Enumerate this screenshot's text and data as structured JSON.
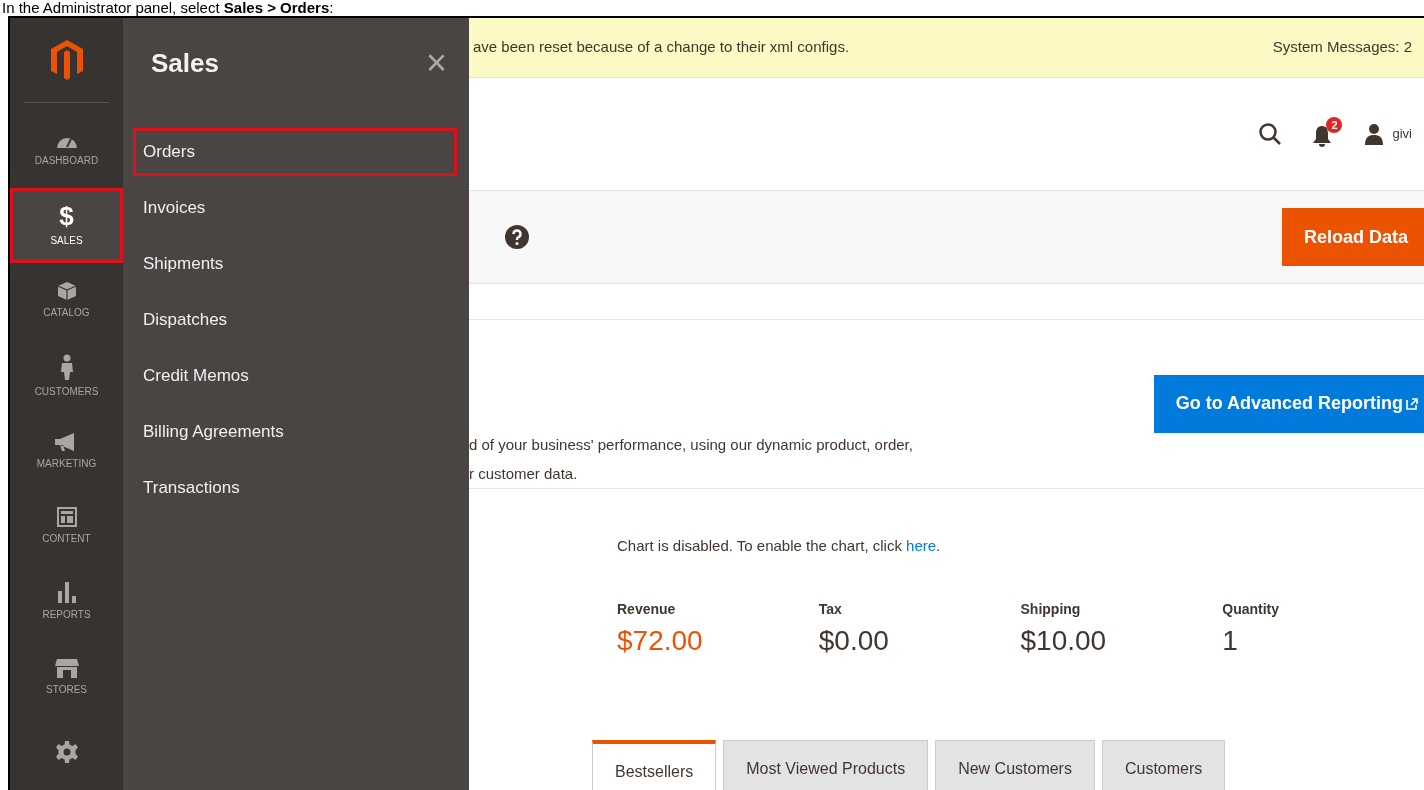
{
  "caption": "In the Administrator panel, select **Sales > Orders**:",
  "sidebar": {
    "items": [
      {
        "label": "DASHBOARD",
        "kind": "dashboard",
        "selected": false,
        "highlighted": false
      },
      {
        "label": "SALES",
        "kind": "sales",
        "glyph": "$",
        "selected": true,
        "highlighted": true
      },
      {
        "label": "CATALOG",
        "kind": "catalog",
        "selected": false,
        "highlighted": false
      },
      {
        "label": "CUSTOMERS",
        "kind": "customers",
        "selected": false,
        "highlighted": false
      },
      {
        "label": "MARKETING",
        "kind": "marketing",
        "selected": false,
        "highlighted": false
      },
      {
        "label": "CONTENT",
        "kind": "content",
        "selected": false,
        "highlighted": false
      },
      {
        "label": "REPORTS",
        "kind": "reports",
        "selected": false,
        "highlighted": false
      },
      {
        "label": "STORES",
        "kind": "stores",
        "selected": false,
        "highlighted": false
      },
      {
        "kind": "system",
        "selected": false,
        "highlighted": false
      }
    ]
  },
  "flyout": {
    "title": "Sales",
    "close": "×",
    "items": [
      {
        "label": "Orders",
        "highlighted": true
      },
      {
        "label": "Invoices",
        "highlighted": false
      },
      {
        "label": "Shipments",
        "highlighted": false
      },
      {
        "label": "Dispatches",
        "highlighted": false
      },
      {
        "label": "Credit Memos",
        "highlighted": false
      },
      {
        "label": "Billing Agreements",
        "highlighted": false
      },
      {
        "label": "Transactions",
        "highlighted": false
      }
    ]
  },
  "message_bar": {
    "text": "ave been reset because of a change to their xml configs.",
    "system_messages": "System Messages: 2"
  },
  "header": {
    "notification_count": "2",
    "user": "givi"
  },
  "toolbar": {
    "reload_button": "Reload Data"
  },
  "advanced_reporting": {
    "lines": [
      "d of your business' performance, using our dynamic product, order,",
      "r customer data."
    ],
    "button": "Go to Advanced Reporting"
  },
  "chart_notice": {
    "text": "Chart is disabled. To enable the chart, click ",
    "link": "here",
    "end": "."
  },
  "stats": [
    {
      "label": "Revenue",
      "value": "$72.00",
      "kind": "revenue"
    },
    {
      "label": "Tax",
      "value": "$0.00",
      "kind": "plain"
    },
    {
      "label": "Shipping",
      "value": "$10.00",
      "kind": "plain"
    },
    {
      "label": "Quantity",
      "value": "1",
      "kind": "plain"
    }
  ],
  "tabs": [
    {
      "label": "Bestsellers",
      "selected": true
    },
    {
      "label": "Most Viewed Products",
      "selected": false
    },
    {
      "label": "New Customers",
      "selected": false
    },
    {
      "label": "Customers",
      "selected": false
    }
  ]
}
